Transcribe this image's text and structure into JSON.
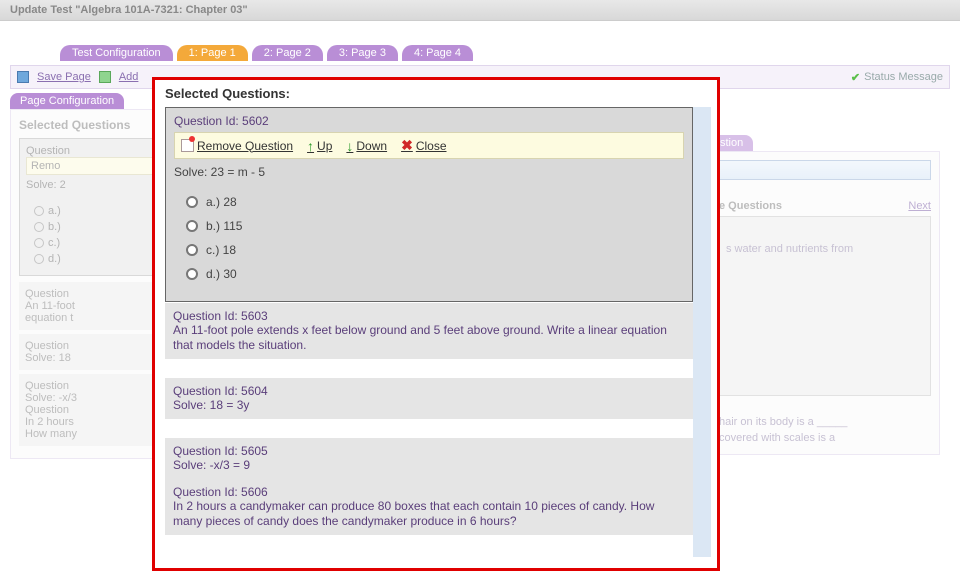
{
  "window_title": "Update Test \"Algebra 101A-7321: Chapter 03\"",
  "tabs": {
    "config": "Test Configuration",
    "pages": [
      "1: Page 1",
      "2: Page 2",
      "3: Page 3",
      "4: Page 4"
    ],
    "active_index": 0
  },
  "toolbar": {
    "save": "Save Page",
    "add": "Add",
    "status": "Status Message"
  },
  "left_section_tab": "Page Configuration",
  "selected_heading_bg": "Selected Questions",
  "bg_q1": {
    "header_action": "Remo",
    "prompt_fragment": "Solve: 2",
    "opts": [
      "a.)",
      "b.)",
      "c.)",
      "d.)"
    ]
  },
  "bg_q2": {
    "line1": "Question",
    "line2": "An 11-foot",
    "line3": "equation t"
  },
  "bg_q3": {
    "line1": "Question",
    "line2": "Solve: 18"
  },
  "bg_q4": {
    "line1": "Question",
    "line2": "Solve: -x/3",
    "line3": "Question",
    "line4": "In 2 hours",
    "line5": "How many"
  },
  "right": {
    "section_tab": "stion",
    "avail_heading": "e Questions",
    "next": "Next",
    "avail_text_fragment": "s water and nutrients from",
    "below1": "hair on its body is a _____",
    "below2": "covered with scales is a"
  },
  "modal": {
    "title": "Selected Questions:",
    "q1": {
      "id_label": "Question Id: 5602",
      "actions": {
        "remove": "Remove Question",
        "up": "Up",
        "down": "Down",
        "close": "Close"
      },
      "prompt": "Solve: 23 = m - 5",
      "options": [
        "a.) 28",
        "b.) 115",
        "c.) 18",
        "d.) 30"
      ]
    },
    "q2": {
      "id": "Question Id: 5603",
      "text": "An 11-foot pole extends x feet below ground and 5 feet above ground. Write a linear equation that models the situation."
    },
    "q3": {
      "id": "Question Id: 5604",
      "text": "Solve: 18 = 3y"
    },
    "q4": {
      "id": "Question Id: 5605",
      "text": "Solve: -x/3 = 9"
    },
    "q5": {
      "id": "Question Id: 5606",
      "text": "In 2 hours a candymaker can produce 80 boxes that each contain 10 pieces of candy. How many pieces of candy does the candymaker produce in 6 hours?"
    }
  }
}
